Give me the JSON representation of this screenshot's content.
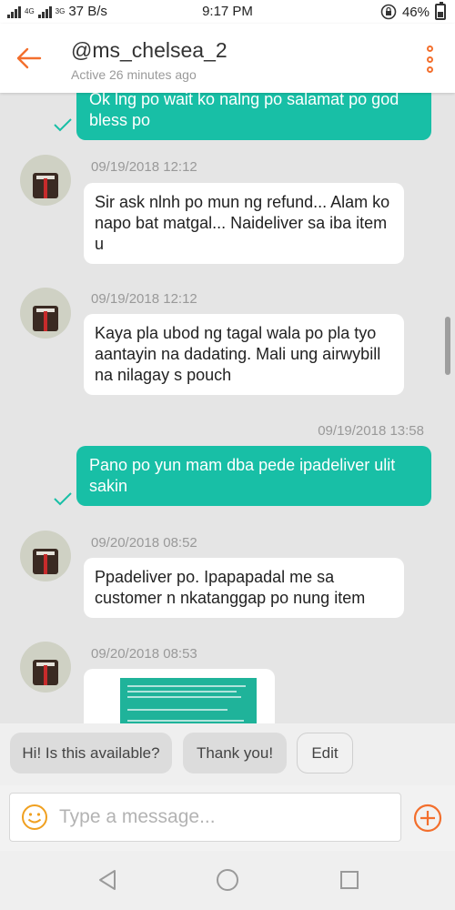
{
  "status_bar": {
    "network_label": "4G",
    "network_label_2": "3G",
    "speed": "37 B/s",
    "time": "9:17 PM",
    "battery": "46%"
  },
  "header": {
    "username": "@ms_chelsea_2",
    "last_active": "Active 26 minutes ago"
  },
  "messages": [
    {
      "direction": "out",
      "text": "Ok lng po wait ko nalng po salamat po god bless po"
    },
    {
      "direction": "in",
      "timestamp": "09/19/2018 12:12",
      "text": "Sir ask nlnh po mun ng refund... Alam ko napo bat matgal... Naideliver sa iba item u"
    },
    {
      "direction": "in",
      "timestamp": "09/19/2018 12:12",
      "text": "Kaya pla ubod ng tagal wala po pla tyo aantayin na dadating. Mali ung airwybill na nilagay s pouch"
    },
    {
      "direction": "out",
      "timestamp": "09/19/2018 13:58",
      "text": "Pano po yun mam dba pede ipadeliver ulit sakin"
    },
    {
      "direction": "in",
      "timestamp": "09/20/2018 08:52",
      "text": "Ppadeliver po. Ipapapadal me sa customer n nkatanggap po nung item"
    },
    {
      "direction": "in",
      "timestamp": "09/20/2018 08:53",
      "type": "image"
    }
  ],
  "quick_replies": [
    "Hi! Is this available?",
    "Thank you!",
    "Edit"
  ],
  "composer": {
    "placeholder": "Type a message..."
  },
  "icons": {
    "back": "back-arrow-icon",
    "more": "more-vertical-icon",
    "emoji": "emoji-icon",
    "add": "plus-circle-icon",
    "read": "check-icon"
  },
  "colors": {
    "accent": "#f36f2d",
    "outgoing_bubble": "#18bfa6",
    "emoji": "#f0a020"
  }
}
